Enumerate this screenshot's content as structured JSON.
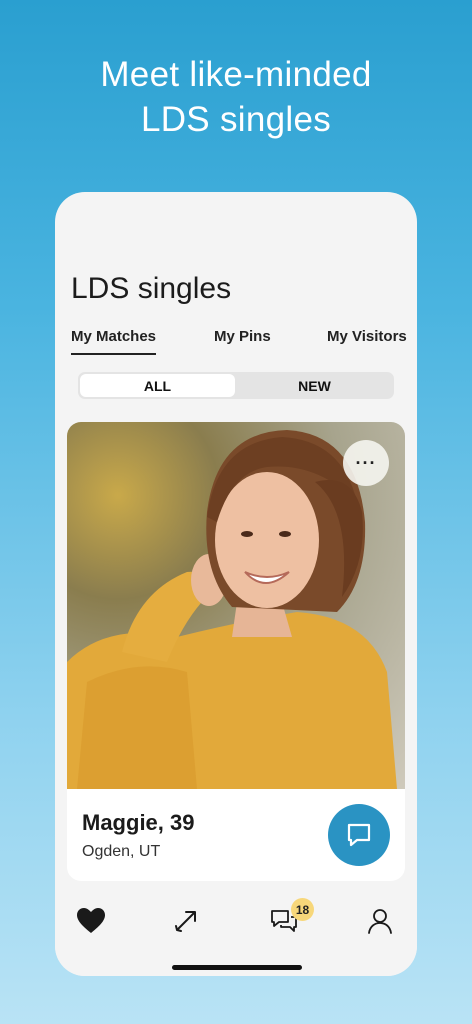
{
  "headline": {
    "line1": "Meet like-minded",
    "line2": "LDS singles"
  },
  "app": {
    "title": "LDS singles",
    "tabs": [
      {
        "label": "My Matches",
        "active": true
      },
      {
        "label": "My Pins",
        "active": false
      },
      {
        "label": "My Visitors",
        "active": false
      }
    ],
    "segments": [
      {
        "label": "ALL",
        "active": true
      },
      {
        "label": "NEW",
        "active": false
      }
    ]
  },
  "profile_card": {
    "more_icon": "more-horizontal-icon",
    "more_label": "···",
    "name": "Maggie, 39",
    "location": "Ogden, UT",
    "chat_icon": "chat-bubble-icon"
  },
  "bottom_nav": {
    "items": [
      {
        "icon": "heart-icon"
      },
      {
        "icon": "arrow-icon"
      },
      {
        "icon": "messages-icon",
        "badge": "18"
      },
      {
        "icon": "profile-icon"
      }
    ]
  },
  "colors": {
    "accent": "#2a93c3",
    "badge": "#f7d77a",
    "background_top": "#2a9fd0",
    "background_bottom": "#b9e3f5"
  }
}
